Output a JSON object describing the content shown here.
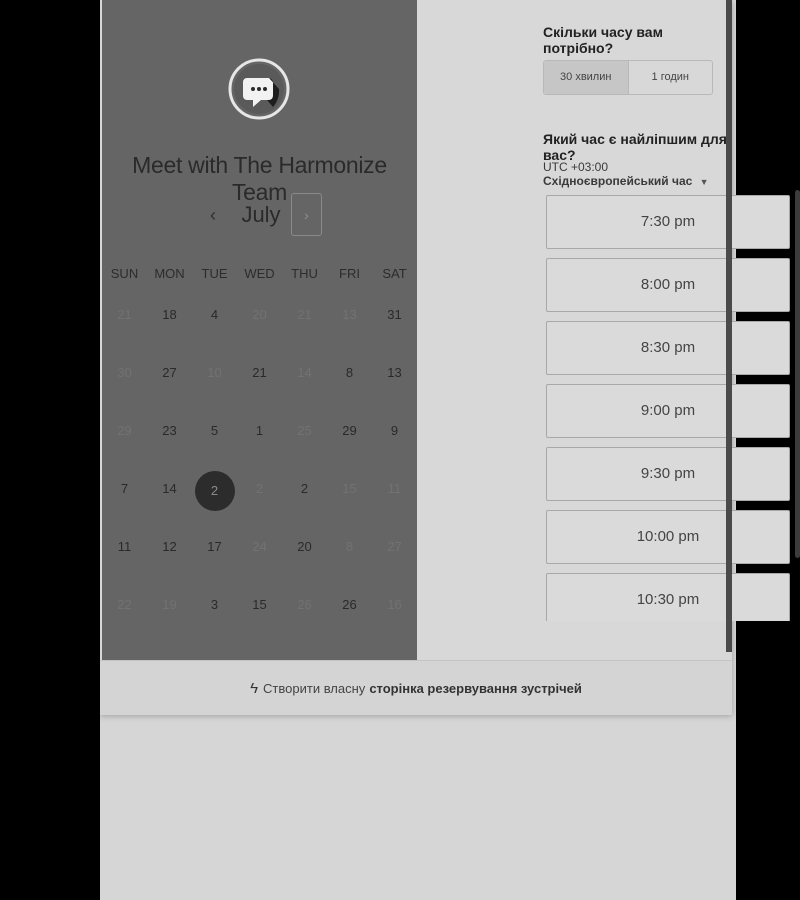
{
  "scheduler": {
    "title": "Meet with The Harmonize Team",
    "avatar_icon": "chat-bubble-icon",
    "month": "July",
    "prev_symbol": "‹",
    "next_symbol": "›",
    "weekdays": [
      "SUN",
      "MON",
      "TUE",
      "WED",
      "THU",
      "FRI",
      "SAT"
    ],
    "weeks": [
      [
        {
          "d": "21",
          "dim": true
        },
        {
          "d": "18",
          "dim": false
        },
        {
          "d": "4",
          "dim": false
        },
        {
          "d": "20",
          "dim": true
        },
        {
          "d": "21",
          "dim": true
        },
        {
          "d": "13",
          "dim": true
        },
        {
          "d": "31",
          "dim": false
        }
      ],
      [
        {
          "d": "30",
          "dim": true
        },
        {
          "d": "27",
          "dim": false
        },
        {
          "d": "10",
          "dim": true
        },
        {
          "d": "21",
          "dim": false
        },
        {
          "d": "14",
          "dim": true
        },
        {
          "d": "8",
          "dim": false
        },
        {
          "d": "13",
          "dim": false
        }
      ],
      [
        {
          "d": "29",
          "dim": true
        },
        {
          "d": "23",
          "dim": false
        },
        {
          "d": "5",
          "dim": false
        },
        {
          "d": "1",
          "dim": false
        },
        {
          "d": "25",
          "dim": true
        },
        {
          "d": "29",
          "dim": false
        },
        {
          "d": "9",
          "dim": false
        }
      ],
      [
        {
          "d": "7",
          "dim": false
        },
        {
          "d": "14",
          "dim": false
        },
        {
          "d": "2",
          "dim": false,
          "selected": true
        },
        {
          "d": "2",
          "dim": true
        },
        {
          "d": "2",
          "dim": false
        },
        {
          "d": "15",
          "dim": true
        },
        {
          "d": "11",
          "dim": true
        }
      ],
      [
        {
          "d": "11",
          "dim": false
        },
        {
          "d": "12",
          "dim": false
        },
        {
          "d": "17",
          "dim": false
        },
        {
          "d": "24",
          "dim": true
        },
        {
          "d": "20",
          "dim": false
        },
        {
          "d": "8",
          "dim": true
        },
        {
          "d": "27",
          "dim": true
        }
      ],
      [
        {
          "d": "22",
          "dim": true
        },
        {
          "d": "19",
          "dim": true
        },
        {
          "d": "3",
          "dim": false
        },
        {
          "d": "15",
          "dim": false
        },
        {
          "d": "26",
          "dim": true
        },
        {
          "d": "26",
          "dim": false
        },
        {
          "d": "16",
          "dim": true
        }
      ]
    ]
  },
  "booking": {
    "duration_question": "Скільки часу вам потрібно?",
    "durations": [
      "30 хвилин",
      "1 годин"
    ],
    "selected_duration": "30 хвилин",
    "time_question": "Який час є найліпшим для вас?",
    "timezone_offset": "UTC +03:00",
    "timezone_name": "Східноєвропейський час",
    "slots": [
      "7:30 pm",
      "8:00 pm",
      "8:30 pm",
      "9:00 pm",
      "9:30 pm",
      "10:00 pm",
      "10:30 pm"
    ]
  },
  "footer": {
    "icon": "hubspot-sprocket-icon",
    "prefix": "Створити власну",
    "link": "сторінка резервування зустрічей"
  }
}
